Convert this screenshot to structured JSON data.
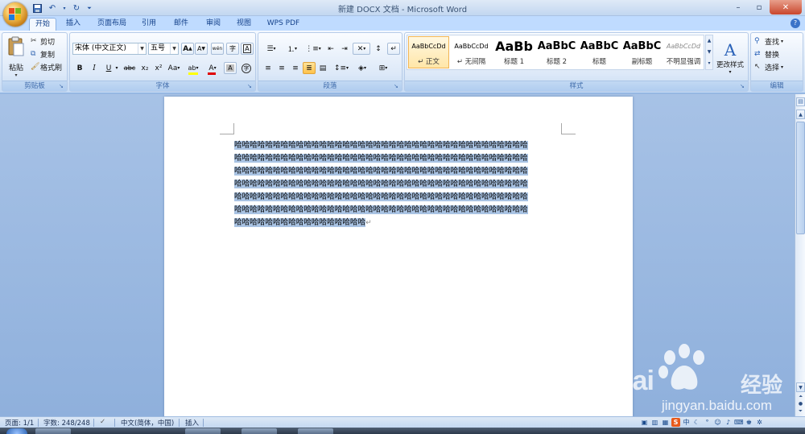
{
  "window": {
    "title": "新建 DOCX 文档 - Microsoft Word",
    "controls": [
      "–",
      "▫",
      "✕"
    ]
  },
  "qat": [
    "save-icon",
    "undo-icon",
    "redo-icon",
    "customize-icon"
  ],
  "tabs": [
    {
      "label": "开始",
      "active": true
    },
    {
      "label": "插入"
    },
    {
      "label": "页面布局"
    },
    {
      "label": "引用"
    },
    {
      "label": "邮件"
    },
    {
      "label": "审阅"
    },
    {
      "label": "视图"
    },
    {
      "label": "WPS PDF"
    }
  ],
  "clipboard": {
    "paste": "粘贴",
    "cut": "剪切",
    "copy": "复制",
    "format_painter": "格式刷",
    "label": "剪贴板"
  },
  "font": {
    "family": "宋体 (中文正文)",
    "size": "五号",
    "label": "字体",
    "grow": "A",
    "shrink": "A",
    "bold": "B",
    "italic": "I",
    "underline": "U",
    "strike": "abc",
    "subscript": "x₂",
    "superscript": "x²",
    "change_case": "Aa",
    "highlight": "ab",
    "font_color": "A",
    "char_shading": "A",
    "enclose": "字",
    "phonetic": "wén",
    "border": "A"
  },
  "paragraph": {
    "label": "段落"
  },
  "styles": {
    "label": "样式",
    "items": [
      {
        "sample": "AaBbCcDd",
        "name": "↵ 正文",
        "selected": true
      },
      {
        "sample": "AaBbCcDd",
        "name": "↵ 无间隔"
      },
      {
        "sample": "AaBb",
        "name": "标题 1"
      },
      {
        "sample": "AaBbC",
        "name": "标题 2"
      },
      {
        "sample": "AaBbC",
        "name": "标题"
      },
      {
        "sample": "AaBbC",
        "name": "副标题"
      },
      {
        "sample": "AaBbCcDd",
        "name": "不明显强调"
      }
    ],
    "change_styles": "更改样式"
  },
  "editing": {
    "find": "查找",
    "replace": "替换",
    "select": "选择",
    "label": "编辑"
  },
  "document": {
    "lines": [
      "哈哈哈哈哈哈哈哈哈哈哈哈哈哈哈哈哈哈哈哈哈哈哈哈哈哈哈哈哈哈哈哈哈哈哈哈哈哈",
      "哈哈哈哈哈哈哈哈哈哈哈哈哈哈哈哈哈哈哈哈哈哈哈哈哈哈哈哈哈哈哈哈哈哈哈哈哈哈",
      "哈哈哈哈哈哈哈哈哈哈哈哈哈哈哈哈哈哈哈哈哈哈哈哈哈哈哈哈哈哈哈哈哈哈哈哈哈哈",
      "哈哈哈哈哈哈哈哈哈哈哈哈哈哈哈哈哈哈哈哈哈哈哈哈哈哈哈哈哈哈哈哈哈哈哈哈哈哈",
      "哈哈哈哈哈哈哈哈哈哈哈哈哈哈哈哈哈哈哈哈哈哈哈哈哈哈哈哈哈哈哈哈哈哈哈哈哈哈",
      "哈哈哈哈哈哈哈哈哈哈哈哈哈哈哈哈哈哈哈哈哈哈哈哈哈哈哈哈哈哈哈哈哈哈哈哈哈哈",
      "哈哈哈哈哈哈哈哈哈哈哈哈哈哈哈哈哈"
    ],
    "paragraph_mark": "↵"
  },
  "status": {
    "page": "页面: 1/1",
    "words": "字数: 248/248",
    "language": "中文(简体，中国)",
    "mode": "插入"
  },
  "watermark": {
    "brand": "Bai",
    "product": "经验",
    "url": "jingyan.baidu.com"
  },
  "colors": {
    "highlight": "#a9c3e3",
    "ribbon_tab": "#bfdbff",
    "selected_style": "#ffe6a8",
    "font_color_bar": "#e00000",
    "highlight_bar": "#ffff00"
  }
}
